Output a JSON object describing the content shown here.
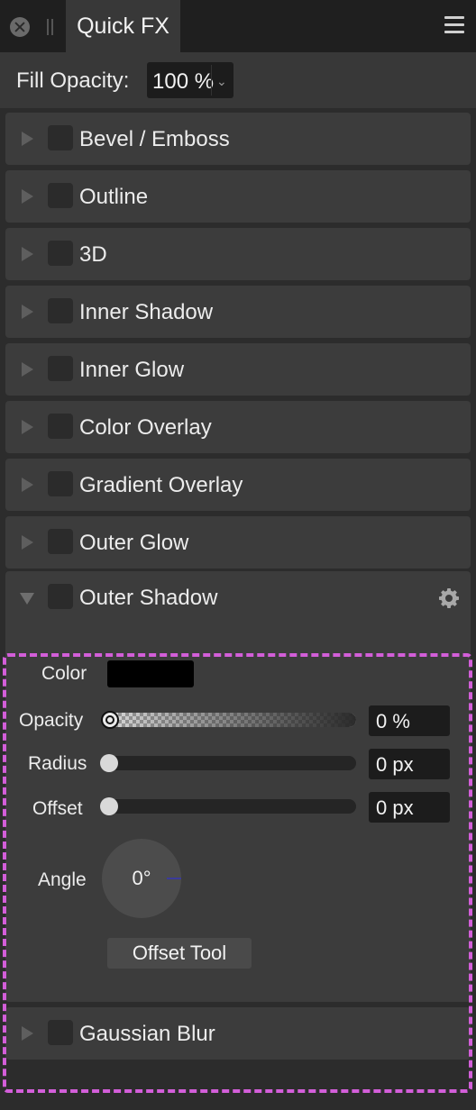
{
  "header": {
    "tab_title": "Quick FX"
  },
  "fill_opacity": {
    "label": "Fill Opacity:",
    "value": "100 %",
    "chevron": "⌄"
  },
  "effects": [
    {
      "label": "Bevel / Emboss",
      "enabled": false,
      "expanded": false
    },
    {
      "label": "Outline",
      "enabled": false,
      "expanded": false
    },
    {
      "label": "3D",
      "enabled": false,
      "expanded": false
    },
    {
      "label": "Inner Shadow",
      "enabled": false,
      "expanded": false
    },
    {
      "label": "Inner Glow",
      "enabled": false,
      "expanded": false
    },
    {
      "label": "Color Overlay",
      "enabled": false,
      "expanded": false
    },
    {
      "label": "Gradient Overlay",
      "enabled": false,
      "expanded": false
    },
    {
      "label": "Outer Glow",
      "enabled": false,
      "expanded": false
    },
    {
      "label": "Outer Shadow",
      "enabled": false,
      "expanded": true
    },
    {
      "label": "Gaussian Blur",
      "enabled": false,
      "expanded": false
    }
  ],
  "outer_shadow": {
    "color_label": "Color",
    "color_value": "#000000",
    "opacity_label": "Opacity",
    "opacity_value": "0 %",
    "opacity_fraction": 0,
    "radius_label": "Radius",
    "radius_value": "0 px",
    "radius_fraction": 0,
    "offset_label": "Offset",
    "offset_value": "0 px",
    "offset_fraction": 0,
    "angle_label": "Angle",
    "angle_value": "0°",
    "offset_tool_label": "Offset Tool"
  },
  "colors": {
    "highlight_dash": "#d35ed9",
    "panel_bg": "#3c3c3c",
    "header_bg": "#1f1f1f"
  }
}
